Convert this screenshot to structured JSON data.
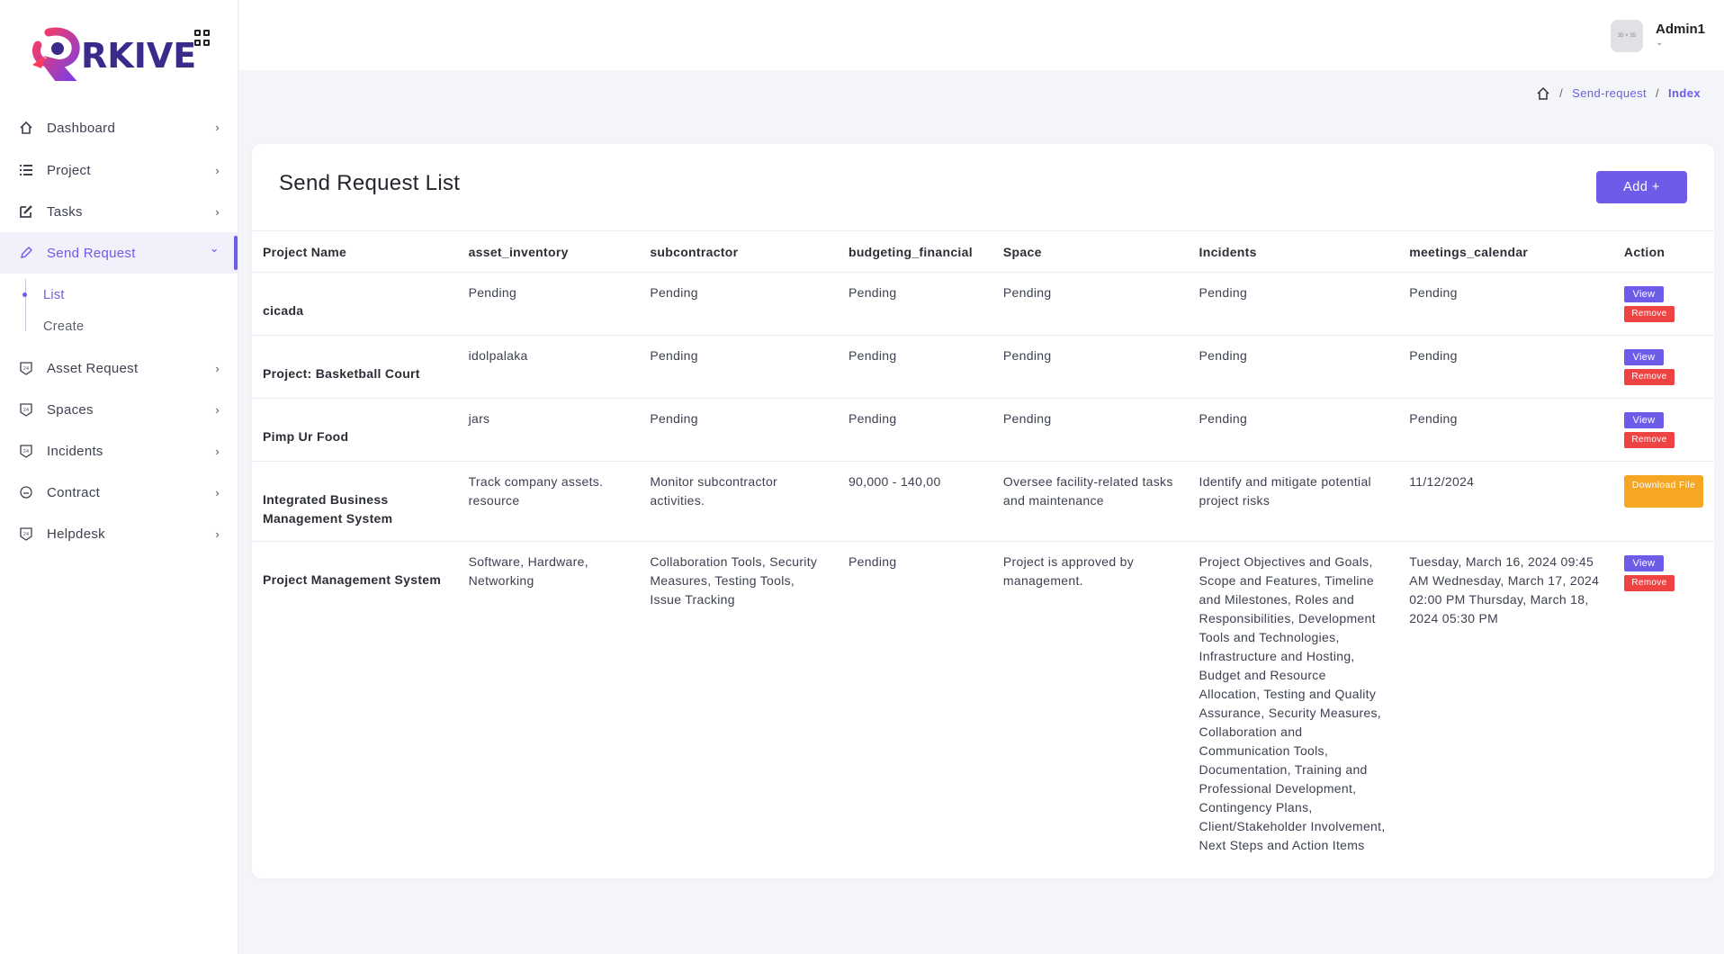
{
  "brand": {
    "name": "RKIVE",
    "color": "#3b2a8c",
    "accent": "#6c5ce7"
  },
  "sidebar": {
    "items": [
      {
        "label": "Dashboard",
        "icon": "home-icon",
        "chevron": "›"
      },
      {
        "label": "Project",
        "icon": "list-icon",
        "chevron": "›"
      },
      {
        "label": "Tasks",
        "icon": "edit-icon",
        "chevron": "›"
      },
      {
        "label": "Send Request",
        "icon": "pencil-icon",
        "chevron": "⌄"
      },
      {
        "label": "Asset Request",
        "icon": "badge-icon",
        "chevron": "›"
      },
      {
        "label": "Spaces",
        "icon": "badge-icon",
        "chevron": "›"
      },
      {
        "label": "Incidents",
        "icon": "badge-icon",
        "chevron": "›"
      },
      {
        "label": "Contract",
        "icon": "contract-icon",
        "chevron": "›"
      },
      {
        "label": "Helpdesk",
        "icon": "badge-icon",
        "chevron": "›"
      }
    ],
    "sub_items": [
      {
        "label": "List"
      },
      {
        "label": "Create"
      }
    ]
  },
  "header": {
    "avatar_text": "35 × 35",
    "user_name": "Admin1"
  },
  "breadcrumb": {
    "items": [
      "Send-request",
      "Index"
    ],
    "separator": "/"
  },
  "card": {
    "title": "Send Request List",
    "add_label": "Add +"
  },
  "table": {
    "columns": [
      "Project Name",
      "asset_inventory",
      "subcontractor",
      "budgeting_financial",
      "Space",
      "Incidents",
      "meetings_calendar",
      "Action"
    ],
    "rows": [
      {
        "name": "cicada",
        "asset": "Pending",
        "subcontractor": "Pending",
        "budget": "Pending",
        "space": "Pending",
        "incidents": "Pending",
        "meetings": "Pending",
        "action": "view-remove"
      },
      {
        "name": "Project: Basketball Court",
        "asset": "idolpalaka",
        "subcontractor": "Pending",
        "budget": "Pending",
        "space": "Pending",
        "incidents": "Pending",
        "meetings": "Pending",
        "action": "view-remove"
      },
      {
        "name": "Pimp Ur Food",
        "asset": "jars",
        "subcontractor": "Pending",
        "budget": "Pending",
        "space": "Pending",
        "incidents": "Pending",
        "meetings": "Pending",
        "action": "view-remove"
      },
      {
        "name": "Integrated Business Management System",
        "asset": "Track company assets. resource",
        "subcontractor": "Monitor subcontractor activities.",
        "budget": "90,000 - 140,00",
        "space": "Oversee facility-related tasks and maintenance",
        "incidents": "Identify and mitigate potential project risks",
        "meetings": "11/12/2024",
        "action": "download"
      },
      {
        "name": "Project Management System",
        "asset": "Software, Hardware, Networking",
        "subcontractor": "Collaboration Tools, Security Measures, Testing Tools, Issue Tracking",
        "budget": "Pending",
        "space": "Project is approved by management.",
        "incidents": "Project Objectives and Goals, Scope and Features, Timeline and Milestones, Roles and Responsibilities, Development Tools and Technologies, Infrastructure and Hosting, Budget and Resource Allocation, Testing and Quality Assurance, Security Measures, Collaboration and Communication Tools, Documentation, Training and Professional Development, Contingency Plans, Client/Stakeholder Involvement, Next Steps and Action Items",
        "meetings": "Tuesday, March 16, 2024 09:45 AM Wednesday, March 17, 2024 02:00 PM Thursday, March 18, 2024 05:30 PM",
        "action": "view-remove"
      }
    ],
    "buttons": {
      "view": "View",
      "remove": "Remove",
      "download": "Download File"
    },
    "colors": {
      "view": "#6c5ce7",
      "remove": "#ee4343",
      "download": "#f5a623"
    }
  }
}
